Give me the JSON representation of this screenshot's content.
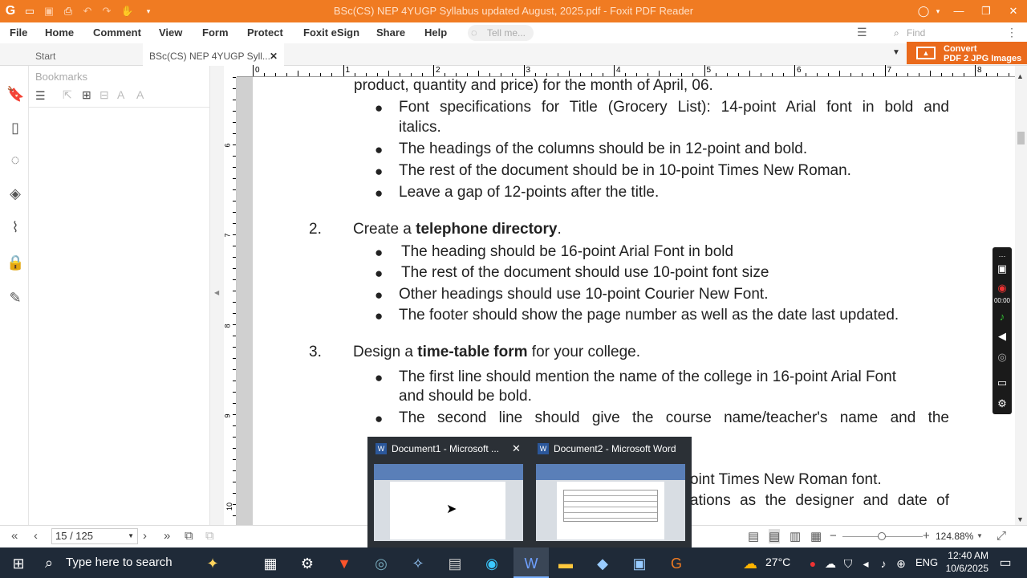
{
  "app": {
    "window_title": "BSc(CS) NEP 4YUGP Syllabus updated August, 2025.pdf - Foxit PDF Reader"
  },
  "menu": {
    "file": "File",
    "home": "Home",
    "comment": "Comment",
    "view": "View",
    "form": "Form",
    "protect": "Protect",
    "esign": "Foxit eSign",
    "share": "Share",
    "help": "Help",
    "tell_me": "Tell me...",
    "find": "Find"
  },
  "tabs": {
    "start": "Start",
    "doc": "BSc(CS) NEP 4YUGP Syll...",
    "convert_line1": "Convert",
    "convert_line2": "PDF 2 JPG Images"
  },
  "bookmarks": {
    "title": "Bookmarks"
  },
  "ruler": {
    "h": [
      "0",
      "1",
      "2",
      "3",
      "4",
      "5",
      "6",
      "7",
      "8"
    ],
    "v": [
      "6",
      "7",
      "8",
      "9",
      "10"
    ]
  },
  "doc": {
    "top_line": "product, quantity and price) for the month of April, 06.",
    "b1a": "Font specifications for Title (Grocery List): 14-point Arial font in bold and",
    "b1a2": "italics.",
    "b1b": "The headings of the columns should be in 12-point and bold.",
    "b1c": "The rest of the document should be in 10-point Times New Roman.",
    "b1d": "Leave a gap of 12-points after the title.",
    "n2": "2.",
    "i2_pre": "Create a ",
    "i2_bold": "telephone directory",
    "i2_post": ".",
    "b2a": "The heading should be 16-point Arial Font in bold",
    "b2b": "The rest of the document should use 10-point font size",
    "b2c": "Other headings should use 10-point Courier New Font.",
    "b2d": "The footer should show the page number as well as the date last updated.",
    "n3": "3.",
    "i3_pre": "Design a ",
    "i3_bold": "time-table form",
    "i3_post": " for your college.",
    "b3a": "The first line should mention the name of the college in 16-point Arial Font",
    "b3a2": "and should be bold.",
    "b3b": "The second line should give the course name/teacher's name and the",
    "b3c_tail": "oint Times New Roman font.",
    "b3d_tail": "ations as the designer and date of"
  },
  "status": {
    "page": "15 / 125",
    "zoom": "124.88%"
  },
  "preview": {
    "item1": "Document1 - Microsoft ...",
    "item2": "Document2 - Microsoft Word"
  },
  "taskbar": {
    "search": "Type here to search",
    "temp": "27°C",
    "lang": "ENG",
    "time": "12:40 AM",
    "date": "10/6/2025"
  },
  "recorder": {
    "time": "00:00"
  },
  "colors": {
    "accent": "#f07b22",
    "taskbar": "#1f2a38"
  }
}
